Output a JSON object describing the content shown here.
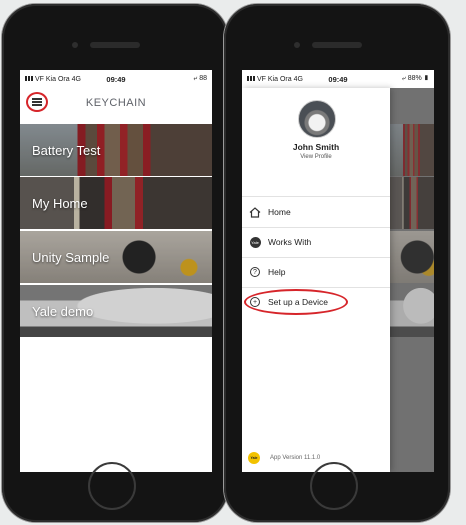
{
  "left_phone": {
    "status": {
      "carrier": "VF Kia Ora  4G",
      "time": "09:49",
      "battery": "88"
    },
    "header": {
      "title": "KEYCHAIN",
      "menu_icon": "hamburger-menu-icon"
    },
    "cards": [
      {
        "label": "Battery Test"
      },
      {
        "label": "My Home"
      },
      {
        "label": "Unity Sample"
      },
      {
        "label": "Yale demo"
      }
    ]
  },
  "right_phone": {
    "status": {
      "carrier": "VF Kia Ora  4G",
      "time": "09:49",
      "battery": "88%"
    },
    "profile": {
      "name": "John Smith",
      "link": "View Profile"
    },
    "nav": [
      {
        "label": "Home",
        "icon": "home-icon"
      },
      {
        "label": "Works With",
        "icon": "works-with-icon",
        "icon_text": "Yale"
      },
      {
        "label": "Help",
        "icon": "help-icon",
        "icon_text": "?"
      },
      {
        "label": "Set up a Device",
        "icon": "add-circle-icon",
        "icon_text": "+"
      }
    ],
    "footer": {
      "logo_text": "Yale",
      "version": "App Version 11.1.0"
    }
  },
  "colors": {
    "highlight_ring": "#d6252a",
    "brand_yellow": "#f2c200",
    "header_text": "#5f6269"
  }
}
